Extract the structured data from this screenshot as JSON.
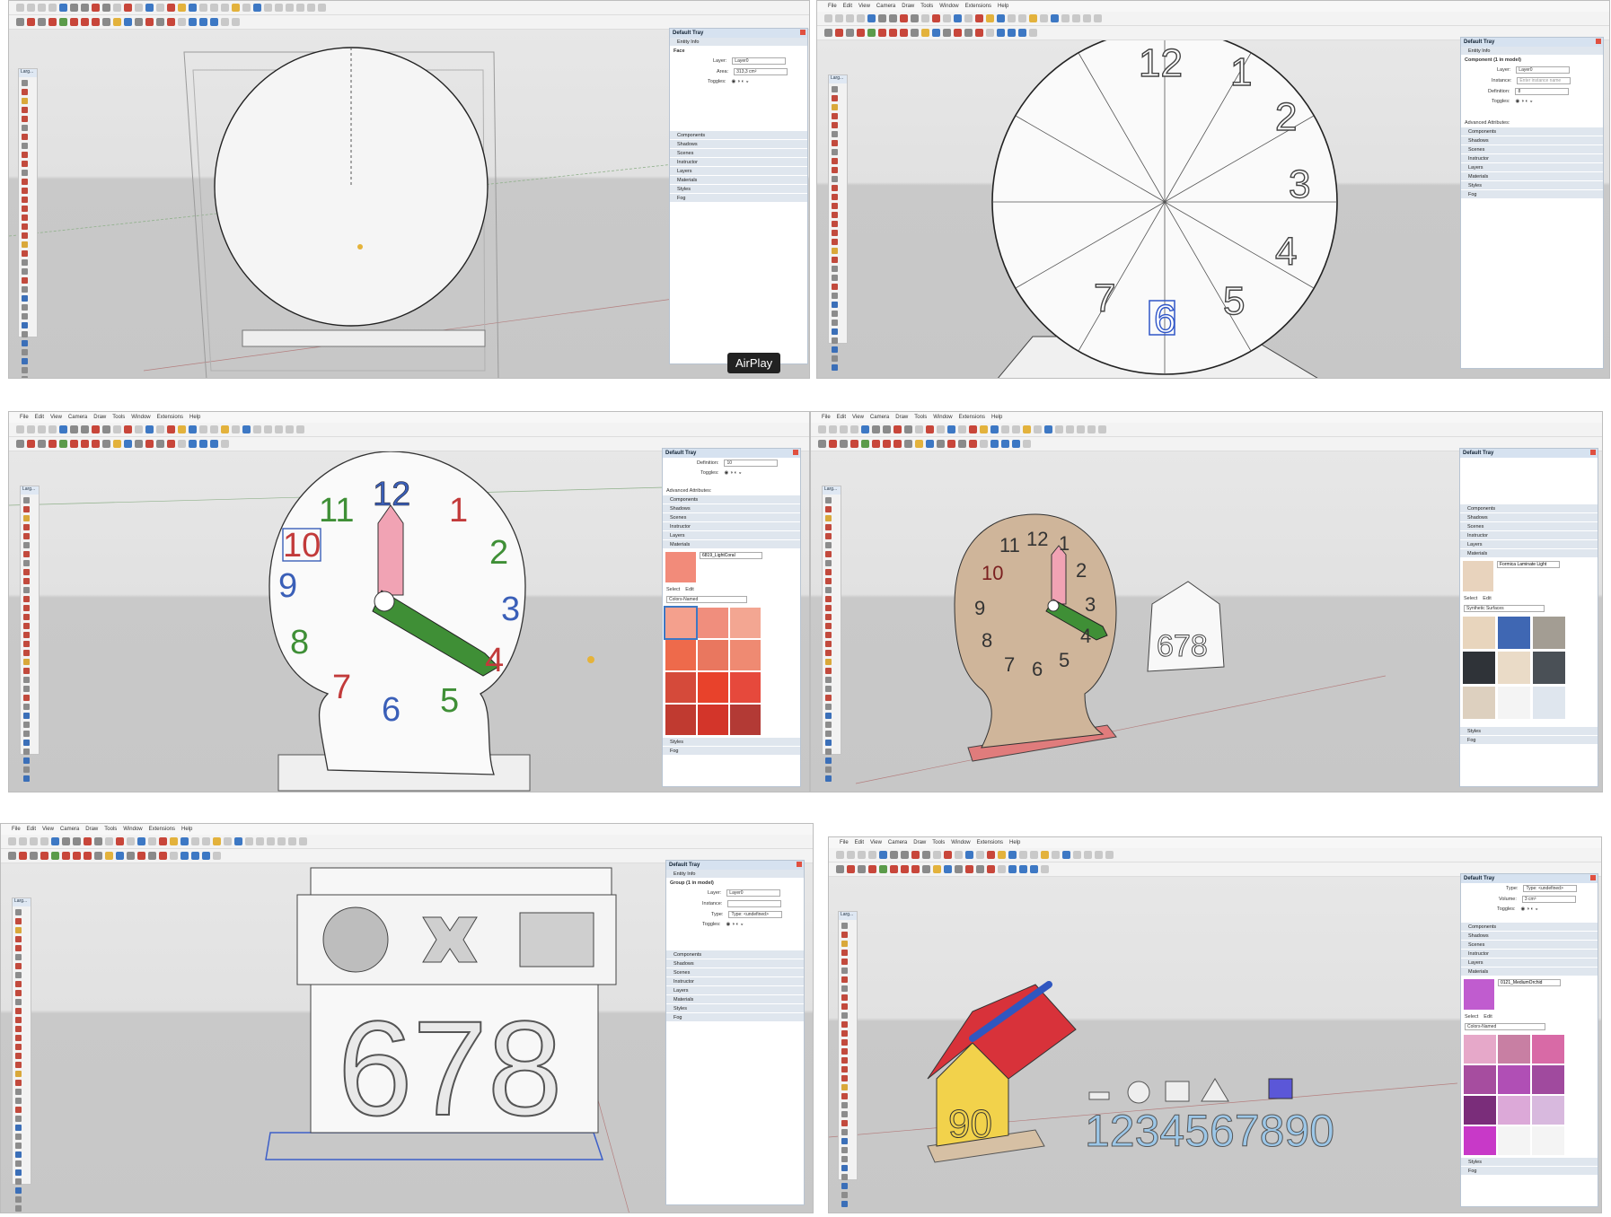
{
  "menus": [
    "File",
    "Edit",
    "View",
    "Camera",
    "Draw",
    "Tools",
    "Window",
    "Extensions",
    "Help"
  ],
  "tools_title": "Larg...",
  "tray": {
    "title": "Default Tray",
    "entity_info": "Entity Info",
    "face": "Face",
    "component": "Component (1 in model)",
    "group": "Group (1 in model)",
    "layer_label": "Layer:",
    "layer_value": "Layer0",
    "area_label": "Area:",
    "area_value": "313,3 cm²",
    "instance_label": "Instance:",
    "instance_placeholder": "Enter instance name",
    "definition_label": "Definition:",
    "definition_value": "8",
    "definition_value_b": "10",
    "type_label": "Type:",
    "type_value": "Type: <undefined>",
    "toggles_label": "Toggles:",
    "volume_label": "Volume:",
    "volume_value": "3 cm³",
    "advanced": "Advanced Attributes:",
    "sections": [
      "Components",
      "Shadows",
      "Scenes",
      "Instructor",
      "Layers",
      "Materials",
      "Styles",
      "Fog"
    ],
    "select": "Select",
    "edit": "Edit",
    "mat1": "6819_LightCoral",
    "lib1": "Colors-Named",
    "mat2": "Formica Laminate Light",
    "lib2": "Synthetic Surfaces",
    "mat3": "0121_MediumOrchid",
    "lib3": "Colors-Named"
  },
  "airplay": "AirPlay",
  "clock_numbers": [
    "12",
    "1",
    "2",
    "3",
    "4",
    "5",
    "6",
    "7",
    "8",
    "9",
    "10",
    "11"
  ],
  "house_numbers": "678",
  "house_front": "90",
  "sorter_numbers": "1234567890",
  "colors": {
    "coral": "#f28b7a",
    "hand_pink": "#f1a3b4",
    "hand_green": "#3f8f36",
    "wood": "#cfb59a",
    "base_red": "#e07c7c",
    "yellow": "#f2d24b",
    "roof_red": "#d8323a",
    "orchid": "#c05ccf"
  }
}
